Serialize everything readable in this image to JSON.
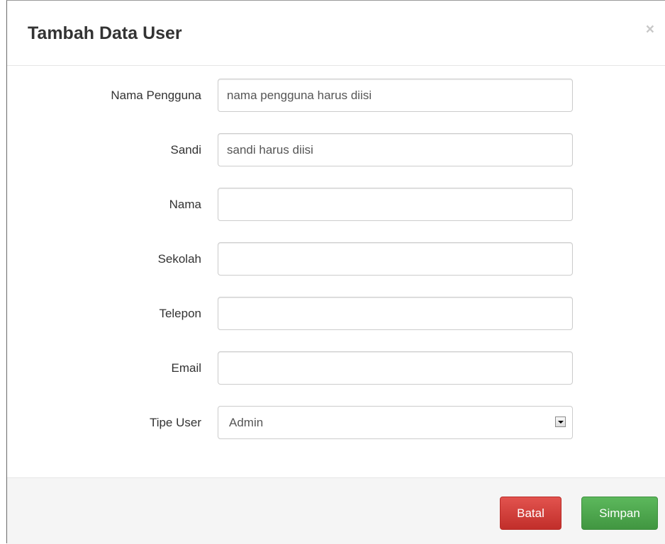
{
  "modal": {
    "title": "Tambah Data User",
    "close_glyph": "×"
  },
  "form": {
    "fields": [
      {
        "label": "Nama Pengguna",
        "value": "",
        "placeholder": "nama pengguna harus diisi"
      },
      {
        "label": "Sandi",
        "value": "",
        "placeholder": "sandi harus diisi"
      },
      {
        "label": "Nama",
        "value": "",
        "placeholder": ""
      },
      {
        "label": "Sekolah",
        "value": "",
        "placeholder": ""
      },
      {
        "label": "Telepon",
        "value": "",
        "placeholder": ""
      },
      {
        "label": "Email",
        "value": "",
        "placeholder": ""
      }
    ],
    "tipe_user": {
      "label": "Tipe User",
      "selected": "Admin"
    }
  },
  "footer": {
    "cancel_label": "Batal",
    "save_label": "Simpan"
  },
  "colors": {
    "danger": "#d9534f",
    "success": "#5cb85c",
    "footer_bg": "#f5f5f5"
  },
  "icons": {
    "close": "close-icon",
    "dropdown": "dropdown-arrow-icon"
  }
}
